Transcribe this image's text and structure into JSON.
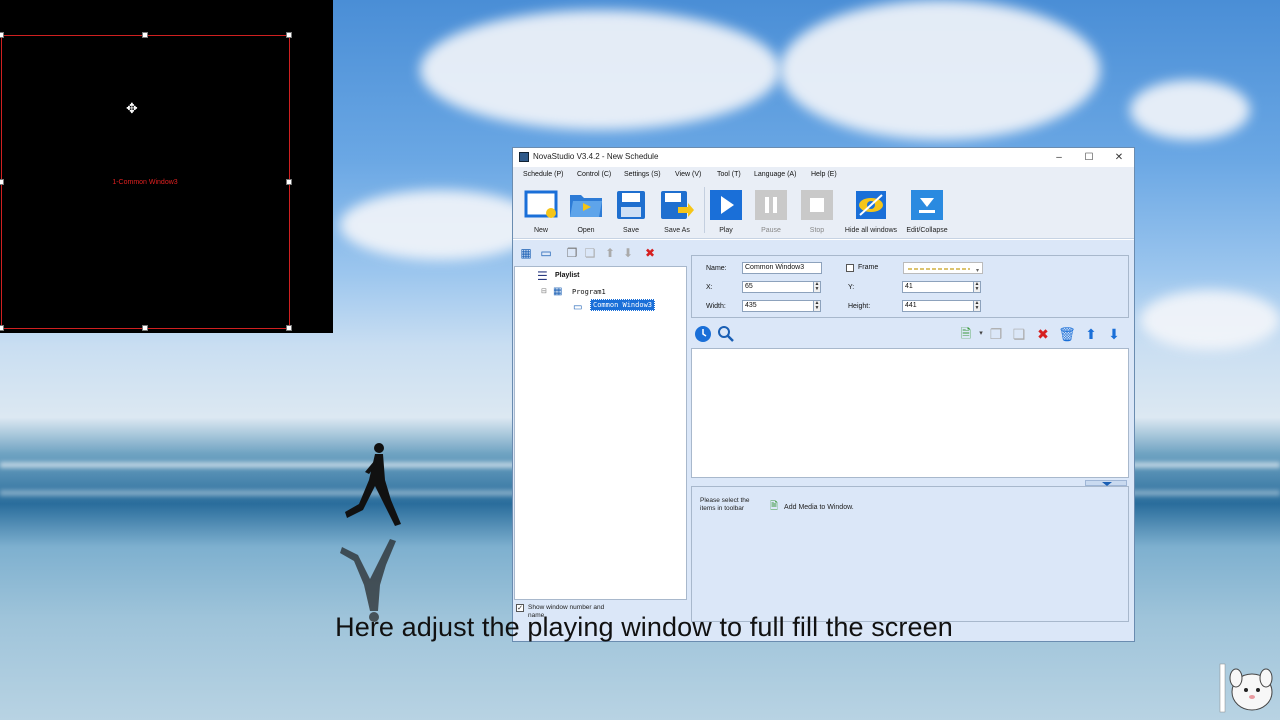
{
  "playing_window": {
    "label": "1-Common Window3"
  },
  "app": {
    "title": "NovaStudio V3.4.2 - New Schedule",
    "window_controls": {
      "minimize": "–",
      "maximize": "☐",
      "close": "✕"
    },
    "menu": [
      {
        "label": "Schedule (P)"
      },
      {
        "label": "Control (C)"
      },
      {
        "label": "Settings (S)"
      },
      {
        "label": "View (V)"
      },
      {
        "label": "Tool (T)"
      },
      {
        "label": "Language (A)"
      },
      {
        "label": "Help (E)"
      }
    ],
    "toolbar": {
      "new": "New",
      "open": "Open",
      "save": "Save",
      "save_as": "Save As",
      "play": "Play",
      "pause": "Pause",
      "stop": "Stop",
      "hide_all": "Hide all windows",
      "edit_collapse": "Edit/Collapse"
    },
    "tree": {
      "root": "Playlist",
      "program": "Program1",
      "window": "Common Window3"
    },
    "show_window_number": "Show window number and name",
    "properties": {
      "name_label": "Name:",
      "name_value": "Common Window3",
      "frame_label": "Frame",
      "x_label": "X:",
      "x_value": "65",
      "y_label": "Y:",
      "y_value": "41",
      "width_label": "Width:",
      "width_value": "435",
      "height_label": "Height:",
      "height_value": "441"
    },
    "hint": "Please select the items in toolbar",
    "add_media": "Add Media to Window."
  },
  "subtitle": "Here adjust the playing window to full fill the screen",
  "colors": {
    "accent": "#1a6fd8",
    "frame_red": "#d02020",
    "panel_bg": "#dbe7f8"
  }
}
